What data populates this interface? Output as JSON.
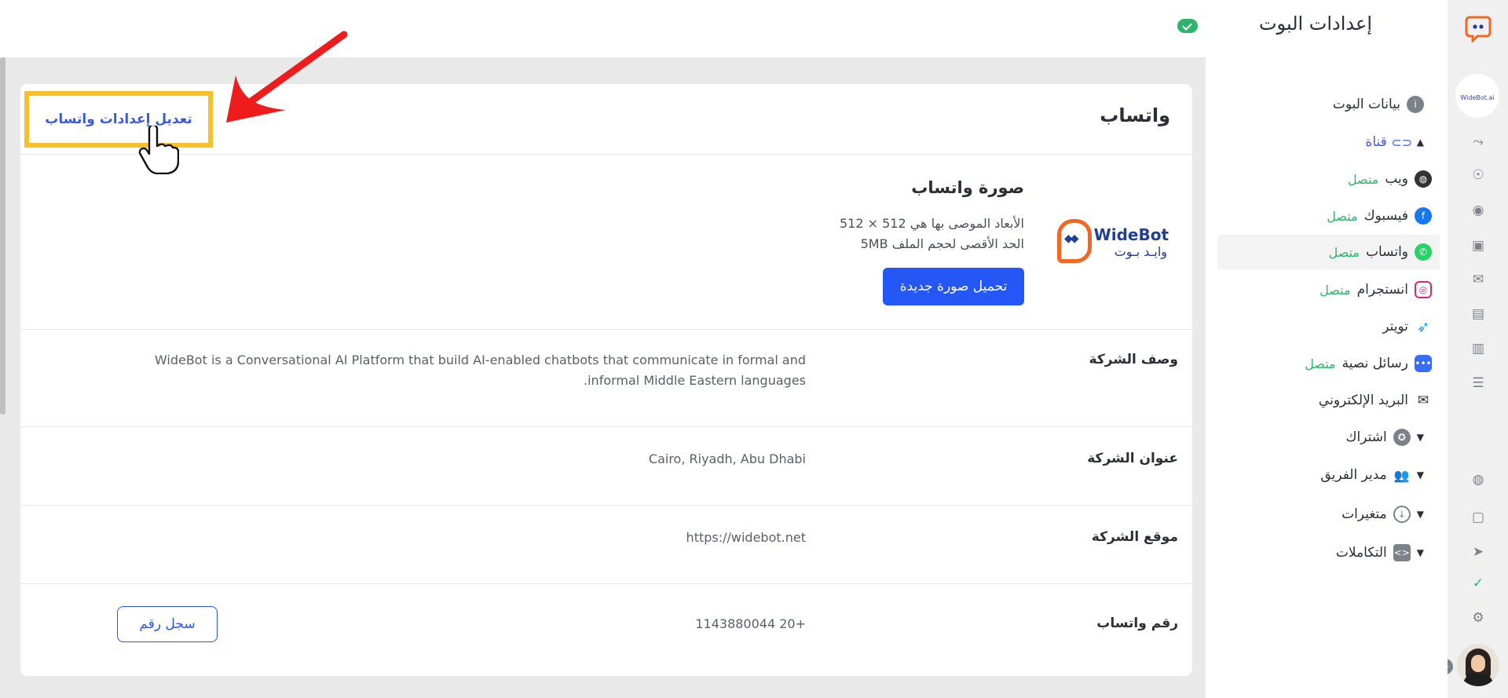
{
  "header": {
    "title": "إعدادات البوت"
  },
  "nav": {
    "bot_data": "بيانات البوت",
    "channel": "قناة",
    "web": {
      "label": "ويب",
      "status": "متصل"
    },
    "facebook": {
      "label": "فيسبوك",
      "status": "متصل"
    },
    "whatsapp": {
      "label": "واتساب",
      "status": "متصل"
    },
    "instagram": {
      "label": "انستجرام",
      "status": "متصل"
    },
    "twitter": {
      "label": "تويتر"
    },
    "sms": {
      "label": "رسائل نصية",
      "status": "متصل"
    },
    "email": {
      "label": "البريد الإلكتروني"
    },
    "subscription": "اشتراك",
    "team": "مدير الفريق",
    "variables": "متغيرات",
    "integrations": "التكاملات"
  },
  "card": {
    "title": "واتساب",
    "edit_link": "تعديل إعدادات واتساب",
    "photo": {
      "title": "صورة واتساب",
      "dims": "الأبعاد الموصى بها هي 512 × 512",
      "size": "الحد الأقصى لحجم الملف 5MB",
      "upload": "تحميل صورة جديدة",
      "logo_en": "WideBot",
      "logo_ar": "وايـد بـوت"
    },
    "rows": [
      {
        "label": "وصف الشركة",
        "value": "WideBot is a Conversational AI Platform that build AI-enabled chatbots that communicate in formal and informal Middle Eastern languages."
      },
      {
        "label": "عنوان الشركة",
        "value": "Cairo, Riyadh, Abu Dhabi"
      },
      {
        "label": "موقع الشركة",
        "value": "https://widebot.net"
      },
      {
        "label": "رقم واتساب",
        "value": "+20 1143880044",
        "button": "سجل رقم"
      }
    ]
  },
  "rail": {
    "bot_label": "WideBot.ai"
  },
  "colors": {
    "primary": "#2457f5",
    "success": "#2db36b",
    "highlight": "#f8c12a",
    "arrow": "#ee1c1c",
    "brand_orange": "#f26722"
  }
}
